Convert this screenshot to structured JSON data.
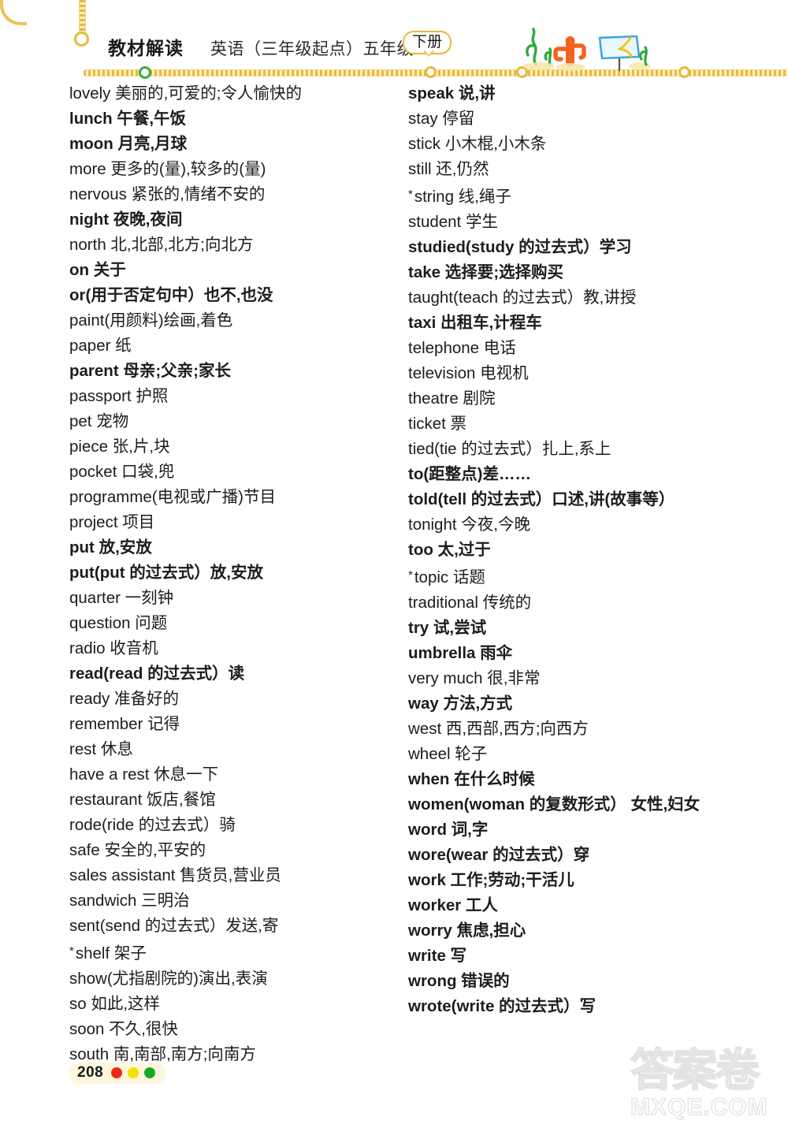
{
  "header": {
    "series_title": "教材解读",
    "subject_title": "英语（三年级起点）五年级",
    "volume_badge": "下册",
    "art_items": [
      "grass-sprout",
      "cactus",
      "signboard",
      "grass-sprout-small"
    ]
  },
  "columns": {
    "left": [
      {
        "text": "lovely 美丽的,可爱的;令人愉快的",
        "bold": false,
        "star": false
      },
      {
        "text": "lunch 午餐,午饭",
        "bold": true,
        "star": false
      },
      {
        "text": "moon 月亮,月球",
        "bold": true,
        "star": false
      },
      {
        "text": "more 更多的(量),较多的(量)",
        "bold": false,
        "star": false
      },
      {
        "text": "nervous 紧张的,情绪不安的",
        "bold": false,
        "star": false
      },
      {
        "text": "night 夜晚,夜间",
        "bold": true,
        "star": false
      },
      {
        "text": "north 北,北部,北方;向北方",
        "bold": false,
        "star": false
      },
      {
        "text": "on 关于",
        "bold": true,
        "star": false
      },
      {
        "text": "or(用于否定句中）也不,也没",
        "bold": true,
        "star": false
      },
      {
        "text": "paint(用颜料)绘画,着色",
        "bold": false,
        "star": false
      },
      {
        "text": "paper 纸",
        "bold": false,
        "star": false
      },
      {
        "text": "parent 母亲;父亲;家长",
        "bold": true,
        "star": false
      },
      {
        "text": "passport 护照",
        "bold": false,
        "star": false
      },
      {
        "text": "pet 宠物",
        "bold": false,
        "star": false
      },
      {
        "text": "piece 张,片,块",
        "bold": false,
        "star": false
      },
      {
        "text": "pocket 口袋,兜",
        "bold": false,
        "star": false
      },
      {
        "text": "programme(电视或广播)节目",
        "bold": false,
        "star": false
      },
      {
        "text": "project 项目",
        "bold": false,
        "star": false
      },
      {
        "text": "put 放,安放",
        "bold": true,
        "star": false
      },
      {
        "text": "put(put 的过去式）放,安放",
        "bold": true,
        "star": false
      },
      {
        "text": "quarter 一刻钟",
        "bold": false,
        "star": false
      },
      {
        "text": "question 问题",
        "bold": false,
        "star": false
      },
      {
        "text": "radio 收音机",
        "bold": false,
        "star": false
      },
      {
        "text": "read(read 的过去式）读",
        "bold": true,
        "star": false
      },
      {
        "text": "ready 准备好的",
        "bold": false,
        "star": false
      },
      {
        "text": "remember 记得",
        "bold": false,
        "star": false
      },
      {
        "text": "rest 休息",
        "bold": false,
        "star": false
      },
      {
        "text": "have a rest 休息一下",
        "bold": false,
        "star": false
      },
      {
        "text": "restaurant 饭店,餐馆",
        "bold": false,
        "star": false
      },
      {
        "text": "rode(ride 的过去式）骑",
        "bold": false,
        "star": false
      },
      {
        "text": "safe 安全的,平安的",
        "bold": false,
        "star": false
      },
      {
        "text": "sales assistant 售货员,营业员",
        "bold": false,
        "star": false
      },
      {
        "text": "sandwich 三明治",
        "bold": false,
        "star": false
      },
      {
        "text": "sent(send 的过去式）发送,寄",
        "bold": false,
        "star": false
      },
      {
        "text": "shelf 架子",
        "bold": false,
        "star": true
      },
      {
        "text": "show(尤指剧院的)演出,表演",
        "bold": false,
        "star": false
      },
      {
        "text": "so 如此,这样",
        "bold": false,
        "star": false
      },
      {
        "text": "soon 不久,很快",
        "bold": false,
        "star": false
      },
      {
        "text": "south 南,南部,南方;向南方",
        "bold": false,
        "star": false
      }
    ],
    "right": [
      {
        "text": "speak 说,讲",
        "bold": true,
        "star": false
      },
      {
        "text": "stay 停留",
        "bold": false,
        "star": false
      },
      {
        "text": "stick 小木棍,小木条",
        "bold": false,
        "star": false
      },
      {
        "text": "still 还,仍然",
        "bold": false,
        "star": false
      },
      {
        "text": "string 线,绳子",
        "bold": false,
        "star": true
      },
      {
        "text": "student 学生",
        "bold": false,
        "star": false
      },
      {
        "text": "studied(study 的过去式）学习",
        "bold": true,
        "star": false
      },
      {
        "text": "take 选择要;选择购买",
        "bold": true,
        "star": false
      },
      {
        "text": "taught(teach 的过去式）教,讲授",
        "bold": false,
        "star": false
      },
      {
        "text": "taxi 出租车,计程车",
        "bold": true,
        "star": false
      },
      {
        "text": "telephone 电话",
        "bold": false,
        "star": false
      },
      {
        "text": "television 电视机",
        "bold": false,
        "star": false
      },
      {
        "text": "theatre 剧院",
        "bold": false,
        "star": false
      },
      {
        "text": "ticket 票",
        "bold": false,
        "star": false
      },
      {
        "text": "tied(tie 的过去式）扎上,系上",
        "bold": false,
        "star": false
      },
      {
        "text": "to(距整点)差……",
        "bold": true,
        "star": false
      },
      {
        "text": "told(tell 的过去式）口述,讲(故事等）",
        "bold": true,
        "star": false
      },
      {
        "text": "tonight 今夜,今晚",
        "bold": false,
        "star": false
      },
      {
        "text": "too 太,过于",
        "bold": true,
        "star": false
      },
      {
        "text": "topic 话题",
        "bold": false,
        "star": true
      },
      {
        "text": "traditional 传统的",
        "bold": false,
        "star": false
      },
      {
        "text": "try 试,尝试",
        "bold": true,
        "star": false
      },
      {
        "text": "umbrella 雨伞",
        "bold": true,
        "star": false
      },
      {
        "text": "very much 很,非常",
        "bold": false,
        "star": false
      },
      {
        "text": "way 方法,方式",
        "bold": true,
        "star": false
      },
      {
        "text": "west 西,西部,西方;向西方",
        "bold": false,
        "star": false
      },
      {
        "text": "wheel 轮子",
        "bold": false,
        "star": false
      },
      {
        "text": "when 在什么时候",
        "bold": true,
        "star": false
      },
      {
        "text": "women(woman 的复数形式） 女性,妇女",
        "bold": true,
        "star": false,
        "justify": true
      },
      {
        "text": "word 词,字",
        "bold": true,
        "star": false
      },
      {
        "text": "wore(wear 的过去式）穿",
        "bold": true,
        "star": false
      },
      {
        "text": "work 工作;劳动;干活儿",
        "bold": true,
        "star": false
      },
      {
        "text": "worker 工人",
        "bold": true,
        "star": false
      },
      {
        "text": "worry 焦虑,担心",
        "bold": true,
        "star": false
      },
      {
        "text": "write 写",
        "bold": true,
        "star": false
      },
      {
        "text": "wrong 错误的",
        "bold": true,
        "star": false
      },
      {
        "text": "wrote(write 的过去式）写",
        "bold": true,
        "star": false
      }
    ]
  },
  "footer": {
    "page_number": "208",
    "dot_colors": [
      "#ee2a18",
      "#f5e003",
      "#17aa26"
    ]
  },
  "watermark": {
    "cn_text": "答案卷",
    "domain_text": "MXQE.COM"
  },
  "theme": {
    "accent_gold": "#e8b93c",
    "accent_green": "#3faa3f",
    "text_color": "#1c1c1c"
  }
}
